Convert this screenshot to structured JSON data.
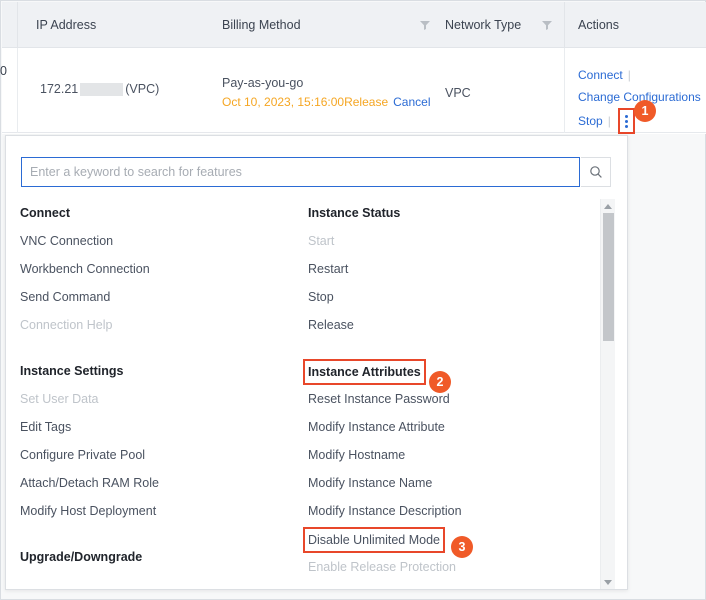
{
  "table": {
    "columns": [
      {
        "label": "IP Address",
        "filter": false
      },
      {
        "label": "Billing Method",
        "filter": true
      },
      {
        "label": "Network Type",
        "filter": true
      },
      {
        "label": "Actions",
        "filter": false
      }
    ],
    "cut_off_text": "0",
    "row": {
      "ip_prefix": "172.21",
      "ip_suffix": "(VPC)",
      "billing_method": "Pay-as-you-go",
      "billing_release": "Oct 10, 2023, 15:16:00Release",
      "billing_cancel": "Cancel",
      "network_type": "VPC",
      "actions": {
        "connect": "Connect",
        "change_configurations": "Change Configurations",
        "stop": "Stop",
        "more_icon": "more-vertical-icon"
      }
    }
  },
  "badges": {
    "one": "1",
    "two": "2",
    "three": "3"
  },
  "panel": {
    "search": {
      "placeholder": "Enter a keyword to search for features",
      "value": "",
      "icon": "search-icon"
    },
    "groups_left": [
      {
        "title": "Connect",
        "items": [
          {
            "label": "VNC Connection",
            "disabled": false
          },
          {
            "label": "Workbench Connection",
            "disabled": false
          },
          {
            "label": "Send Command",
            "disabled": false
          },
          {
            "label": "Connection Help",
            "disabled": true
          }
        ]
      },
      {
        "title": "Instance Settings",
        "items": [
          {
            "label": "Set User Data",
            "disabled": true
          },
          {
            "label": "Edit Tags",
            "disabled": false
          },
          {
            "label": "Configure Private Pool",
            "disabled": false
          },
          {
            "label": "Attach/Detach RAM Role",
            "disabled": false
          },
          {
            "label": "Modify Host Deployment",
            "disabled": false
          }
        ]
      },
      {
        "title": "Upgrade/Downgrade",
        "items": []
      }
    ],
    "groups_right": [
      {
        "title": "Instance Status",
        "highlighted": false,
        "items": [
          {
            "label": "Start",
            "disabled": true
          },
          {
            "label": "Restart",
            "disabled": false
          },
          {
            "label": "Stop",
            "disabled": false
          },
          {
            "label": "Release",
            "disabled": false
          }
        ]
      },
      {
        "title": "Instance Attributes",
        "highlighted": true,
        "items": [
          {
            "label": "Reset Instance Password",
            "disabled": false
          },
          {
            "label": "Modify Instance Attribute",
            "disabled": false
          },
          {
            "label": "Modify Hostname",
            "disabled": false
          },
          {
            "label": "Modify Instance Name",
            "disabled": false
          },
          {
            "label": "Modify Instance Description",
            "disabled": false
          },
          {
            "label": "Disable Unlimited Mode",
            "disabled": false,
            "highlighted": true
          },
          {
            "label": "Enable Release Protection",
            "disabled": true
          }
        ]
      }
    ]
  },
  "colors": {
    "accent_link": "#2b6bd4",
    "highlight_box": "#e8472a",
    "badge": "#f05a28",
    "warning_text": "#f5a623",
    "header_bg": "#eff1f4"
  }
}
